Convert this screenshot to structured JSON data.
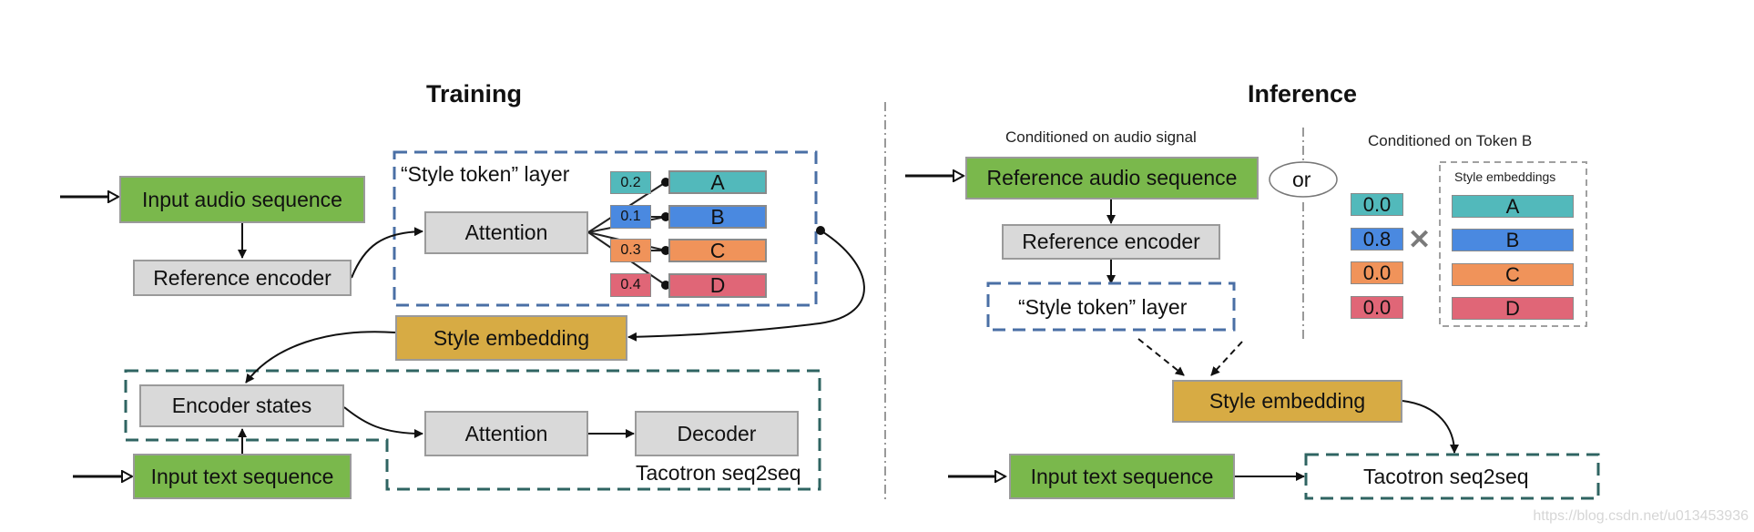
{
  "colors": {
    "input_green": "#7ab84c",
    "module_gray": "#d9d9d9",
    "style_gold": "#d7ab44",
    "token_a": "#52b9bb",
    "token_b": "#4a89e0",
    "token_c": "#f0935a",
    "token_d": "#e06677",
    "style_layer_border": "#4a6fa5",
    "seq2seq_border": "#2f6462"
  },
  "training": {
    "title": "Training",
    "input_audio": "Input audio sequence",
    "reference_encoder": "Reference encoder",
    "style_token_layer_label": "“Style token” layer",
    "attention": "Attention",
    "tokens": [
      {
        "weight": "0.2",
        "label": "A"
      },
      {
        "weight": "0.1",
        "label": "B"
      },
      {
        "weight": "0.3",
        "label": "C"
      },
      {
        "weight": "0.4",
        "label": "D"
      }
    ],
    "style_embedding": "Style embedding",
    "encoder_states": "Encoder states",
    "decoder_attention": "Attention",
    "decoder": "Decoder",
    "seq2seq_label": "Tacotron seq2seq",
    "input_text": "Input text sequence"
  },
  "inference": {
    "title": "Inference",
    "audio_caption": "Conditioned on audio signal",
    "token_caption": "Conditioned on Token B",
    "or_label": "or",
    "reference_audio": "Reference audio sequence",
    "reference_encoder": "Reference encoder",
    "style_token_layer": "“Style token” layer",
    "style_embeddings_label": "Style embeddings",
    "multiply_symbol": "✕",
    "tokens": [
      {
        "weight": "0.0",
        "label": "A"
      },
      {
        "weight": "0.8",
        "label": "B"
      },
      {
        "weight": "0.0",
        "label": "C"
      },
      {
        "weight": "0.0",
        "label": "D"
      }
    ],
    "style_embedding": "Style embedding",
    "input_text": "Input text sequence",
    "seq2seq": "Tacotron seq2seq"
  },
  "watermark": "https://blog.csdn.net/u013453936"
}
